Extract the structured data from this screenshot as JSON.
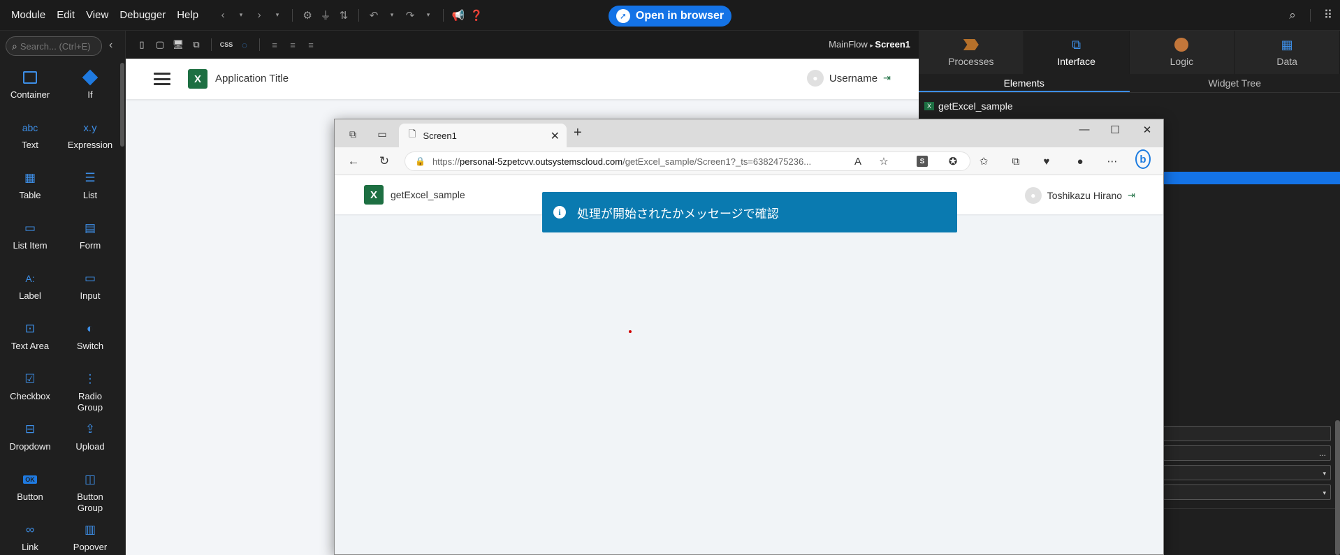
{
  "menubar": {
    "items": [
      "Module",
      "Edit",
      "View",
      "Debugger",
      "Help"
    ],
    "open_in_browser": "Open in browser"
  },
  "toolbox": {
    "search_placeholder": "Search... (Ctrl+E)",
    "tools": [
      {
        "label": "Container",
        "icon": "container-icon"
      },
      {
        "label": "If",
        "icon": "if-icon"
      },
      {
        "label": "Text",
        "icon": "text-icon",
        "glyph": "abc"
      },
      {
        "label": "Expression",
        "icon": "expression-icon",
        "glyph": "x.y"
      },
      {
        "label": "Table",
        "icon": "table-icon"
      },
      {
        "label": "List",
        "icon": "list-icon"
      },
      {
        "label": "List Item",
        "icon": "list-item-icon"
      },
      {
        "label": "Form",
        "icon": "form-icon"
      },
      {
        "label": "Label",
        "icon": "label-icon",
        "glyph": "A:"
      },
      {
        "label": "Input",
        "icon": "input-icon"
      },
      {
        "label": "Text Area",
        "icon": "text-area-icon"
      },
      {
        "label": "Switch",
        "icon": "switch-icon"
      },
      {
        "label": "Checkbox",
        "icon": "checkbox-icon"
      },
      {
        "label": "Radio Group",
        "icon": "radio-group-icon"
      },
      {
        "label": "Dropdown",
        "icon": "dropdown-icon"
      },
      {
        "label": "Upload",
        "icon": "upload-icon"
      },
      {
        "label": "Button",
        "icon": "button-icon",
        "glyph": "OK"
      },
      {
        "label": "Button Group",
        "icon": "button-group-icon"
      },
      {
        "label": "Link",
        "icon": "link-icon"
      },
      {
        "label": "Popover Menu",
        "icon": "popover-menu-icon"
      }
    ]
  },
  "canvas": {
    "breadcrumb_flow": "MainFlow",
    "breadcrumb_screen": "Screen1",
    "app_title": "Application Title",
    "username": "Username",
    "logo_letter": "X"
  },
  "right_panel": {
    "tabs": [
      "Processes",
      "Interface",
      "Logic",
      "Data"
    ],
    "subtabs": [
      "Elements",
      "Widget Tree"
    ],
    "tree_item": "getExcel_sample",
    "prop_field_more": "..."
  },
  "browser": {
    "tab_title": "Screen1",
    "url_prefix": "https://",
    "url_host": "personal-5zpetcvv.outsystemscloud.com",
    "url_path": "/getExcel_sample/Screen1?_ts=6382475236...",
    "page_title": "getExcel_sample",
    "page_user": "Toshikazu Hirano",
    "message": "処理が開始されたかメッセージで確認",
    "s_badge": "S",
    "bing": "b"
  },
  "colors": {
    "accent": "#1473e6",
    "excel_green": "#1d6f42",
    "feedback_bg": "#0a7ab0"
  }
}
